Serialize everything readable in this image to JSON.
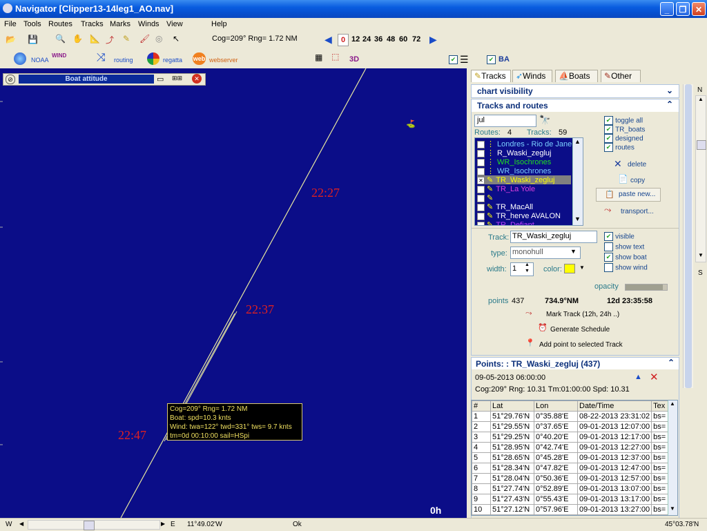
{
  "window": {
    "title": "Navigator [Clipper13-14leg1_AO.nav]"
  },
  "menu": [
    "File",
    "Tools",
    "Routes",
    "Tracks",
    "Marks",
    "Winds",
    "View",
    "Help"
  ],
  "toolbar": {
    "cog_readout": "Cog=209° Rng= 1.72 NM",
    "time_steps": [
      "0",
      "12",
      "24",
      "36",
      "48",
      "60",
      "72"
    ],
    "noaa": "NOAA",
    "wind": "WIND",
    "routing": "routing",
    "regatta": "regatta",
    "web": "web",
    "webserver": "webserver",
    "three_d": "3D",
    "ba": "BA"
  },
  "boat_attitude": {
    "title": "Boat attitude"
  },
  "map": {
    "times": [
      "22:27",
      "22:37",
      "22:47"
    ],
    "hours_label": "0h",
    "tooltip": [
      "Cog=209° Rng= 1.72 NM",
      "Boat: spd=10.3 knts",
      "Wind: twa=122° twd=331° tws= 9.7 knts",
      "tm=0d 00:10:00 sail=HSpi"
    ],
    "colors": {
      "sea": "#0b0d88",
      "track": "#e8e8a0",
      "time_labels": "#e02020"
    }
  },
  "tabs": [
    "Tracks",
    "Winds",
    "Boats",
    "Other"
  ],
  "chart_visibility": {
    "title": "chart visibility"
  },
  "tracks_routes": {
    "title": "Tracks and routes",
    "search_value": "jul",
    "routes_label": "Routes:",
    "routes_count": "4",
    "tracks_label": "Tracks:",
    "tracks_count": "59",
    "items": [
      {
        "name": "Londres - Rio de Janeiro",
        "color": "#7ad0ff",
        "checked": false,
        "selected": false
      },
      {
        "name": "R_Waski_zegluj",
        "color": "#ffffff",
        "checked": false,
        "selected": false
      },
      {
        "name": "WR_Isochrones",
        "color": "#20e020",
        "checked": false,
        "selected": false
      },
      {
        "name": "WR_Isochrones",
        "color": "#7ad0ff",
        "checked": false,
        "selected": false
      },
      {
        "name": "TR_Waski_zegluj",
        "color": "#ffff00",
        "checked": true,
        "selected": true
      },
      {
        "name": "TR_La Yole",
        "color": "#e040e0",
        "checked": false,
        "selected": false
      },
      {
        "name": "",
        "color": "#2040ff",
        "checked": false,
        "selected": false
      },
      {
        "name": "TR_MacAll",
        "color": "#ffffff",
        "checked": false,
        "selected": false
      },
      {
        "name": "TR_herve AVALON",
        "color": "#ffffff",
        "checked": false,
        "selected": false
      },
      {
        "name": "TR_Defiant",
        "color": "#c040ff",
        "checked": false,
        "selected": false
      }
    ],
    "toggles": [
      "toggle all",
      "TR_boats",
      "designed",
      "routes"
    ],
    "actions": {
      "delete": "delete",
      "copy": "copy",
      "paste": "paste new...",
      "transport": "transport..."
    }
  },
  "track_props": {
    "track_label": "Track:",
    "track_value": "TR_Waski_zegluj",
    "type_label": "type:",
    "type_value": "monohull",
    "width_label": "width:",
    "width_value": "1",
    "color_label": "color:",
    "color_value": "#ffff00",
    "opacity_label": "opacity",
    "opacity": 0.9,
    "visible": "visible",
    "show_text": "show text",
    "show_boat": "show boat",
    "show_wind": "show wind",
    "points_label": "points",
    "points_value": "437",
    "distance": "734.9°NM",
    "duration": "12d 23:35:58",
    "mark_track": "Mark Track (12h, 24h ..)",
    "gen_schedule": "Generate Schedule",
    "add_point": "Add point to selected Track"
  },
  "points": {
    "title": "Points: : TR_Waski_zegluj (437)",
    "line1": "09-05-2013 06:00:00",
    "line2": "Cog:209° Rng: 10.31 Tm:01:00:00 Spd: 10.31",
    "columns": [
      "#",
      "Lat",
      "Lon",
      "Date/Time",
      "Tex"
    ],
    "rows": [
      [
        "1",
        "51°29.76'N",
        "0°35.88'E",
        "08-22-2013 23:31:02",
        "bs="
      ],
      [
        "2",
        "51°29.55'N",
        "0°37.65'E",
        "09-01-2013 12:07:00",
        "bs="
      ],
      [
        "3",
        "51°29.25'N",
        "0°40.20'E",
        "09-01-2013 12:17:00",
        "bs="
      ],
      [
        "4",
        "51°28.95'N",
        "0°42.74'E",
        "09-01-2013 12:27:00",
        "bs="
      ],
      [
        "5",
        "51°28.65'N",
        "0°45.28'E",
        "09-01-2013 12:37:00",
        "bs="
      ],
      [
        "6",
        "51°28.34'N",
        "0°47.82'E",
        "09-01-2013 12:47:00",
        "bs="
      ],
      [
        "7",
        "51°28.04'N",
        "0°50.36'E",
        "09-01-2013 12:57:00",
        "bs="
      ],
      [
        "8",
        "51°27.74'N",
        "0°52.89'E",
        "09-01-2013 13:07:00",
        "bs="
      ],
      [
        "9",
        "51°27.43'N",
        "0°55.43'E",
        "09-01-2013 13:17:00",
        "bs="
      ],
      [
        "10",
        "51°27.12'N",
        "0°57.96'E",
        "09-01-2013 13:27:00",
        "bs="
      ]
    ]
  },
  "side_letters": {
    "n": "N",
    "s": "S"
  },
  "status": {
    "w": "W",
    "e": "E",
    "lon": "11°49.02'W",
    "ok": "Ok",
    "lat": "45°03.78'N"
  }
}
